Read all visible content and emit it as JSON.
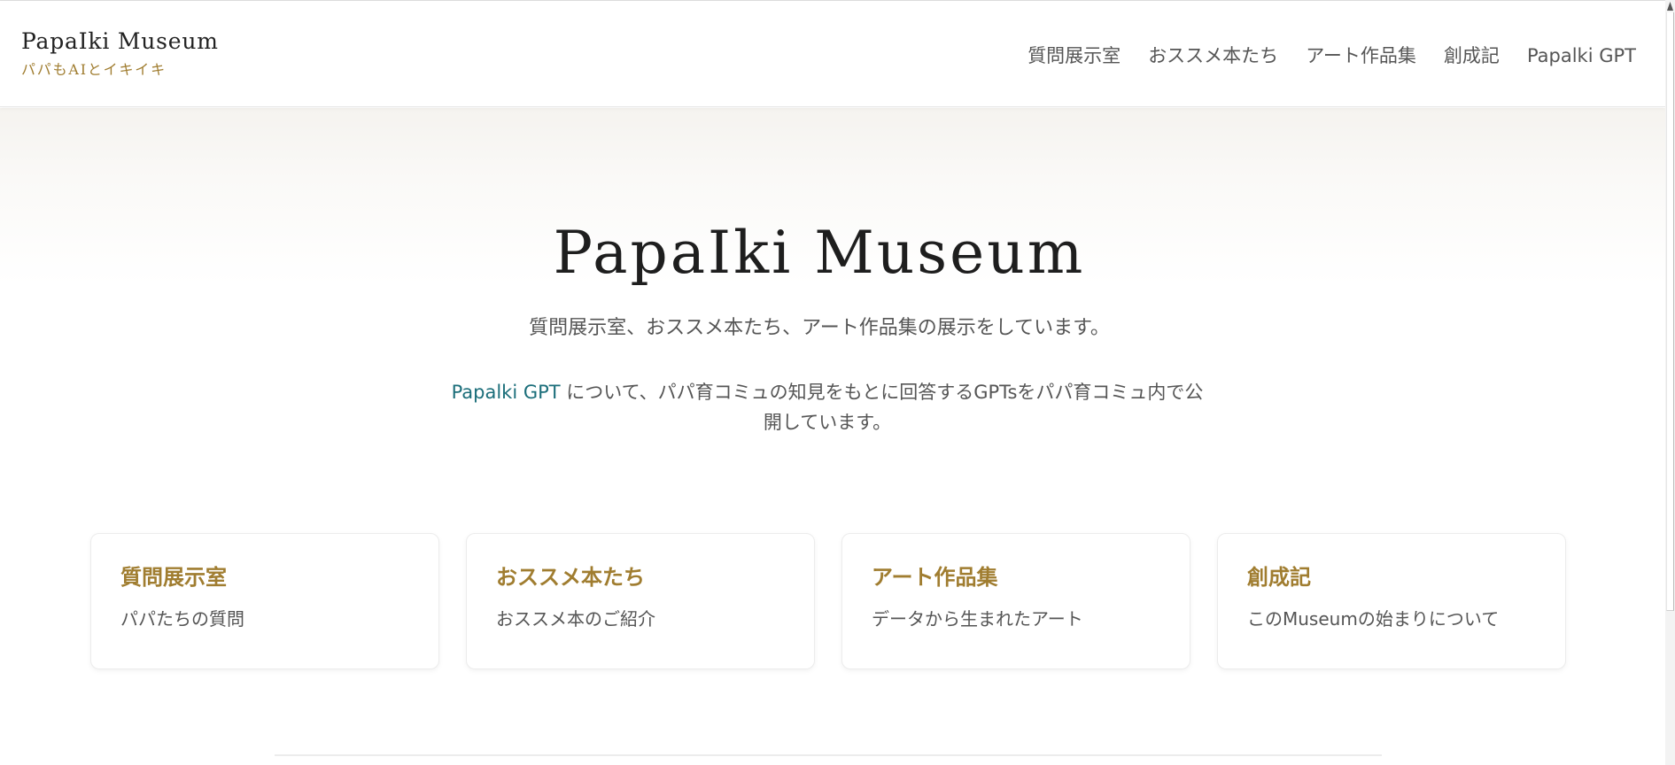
{
  "header": {
    "brand_title": "PapaIki Museum",
    "brand_tagline": "パパもAIとイキイキ",
    "nav": [
      {
        "label": "質問展示室"
      },
      {
        "label": "おススメ本たち"
      },
      {
        "label": "アート作品集"
      },
      {
        "label": "創成記"
      },
      {
        "label": "Papalki GPT"
      }
    ]
  },
  "hero": {
    "title": "PapaIki Museum",
    "subtitle": "質問展示室、おススメ本たち、アート作品集の展示をしています。",
    "gpt_link": "Papalki GPT",
    "gpt_text": " について、パパ育コミュの知見をもとに回答するGPTsをパパ育コミュ内で公開しています。"
  },
  "cards": [
    {
      "title": "質問展示室",
      "desc": "パパたちの質問"
    },
    {
      "title": "おススメ本たち",
      "desc": "おススメ本のご紹介"
    },
    {
      "title": "アート作品集",
      "desc": "データから生まれたアート"
    },
    {
      "title": "創成記",
      "desc": "このMuseumの始まりについて"
    }
  ],
  "colors": {
    "accent_gold": "#a07d30",
    "link_teal": "#1b6e7a",
    "text_gray": "#555555"
  }
}
